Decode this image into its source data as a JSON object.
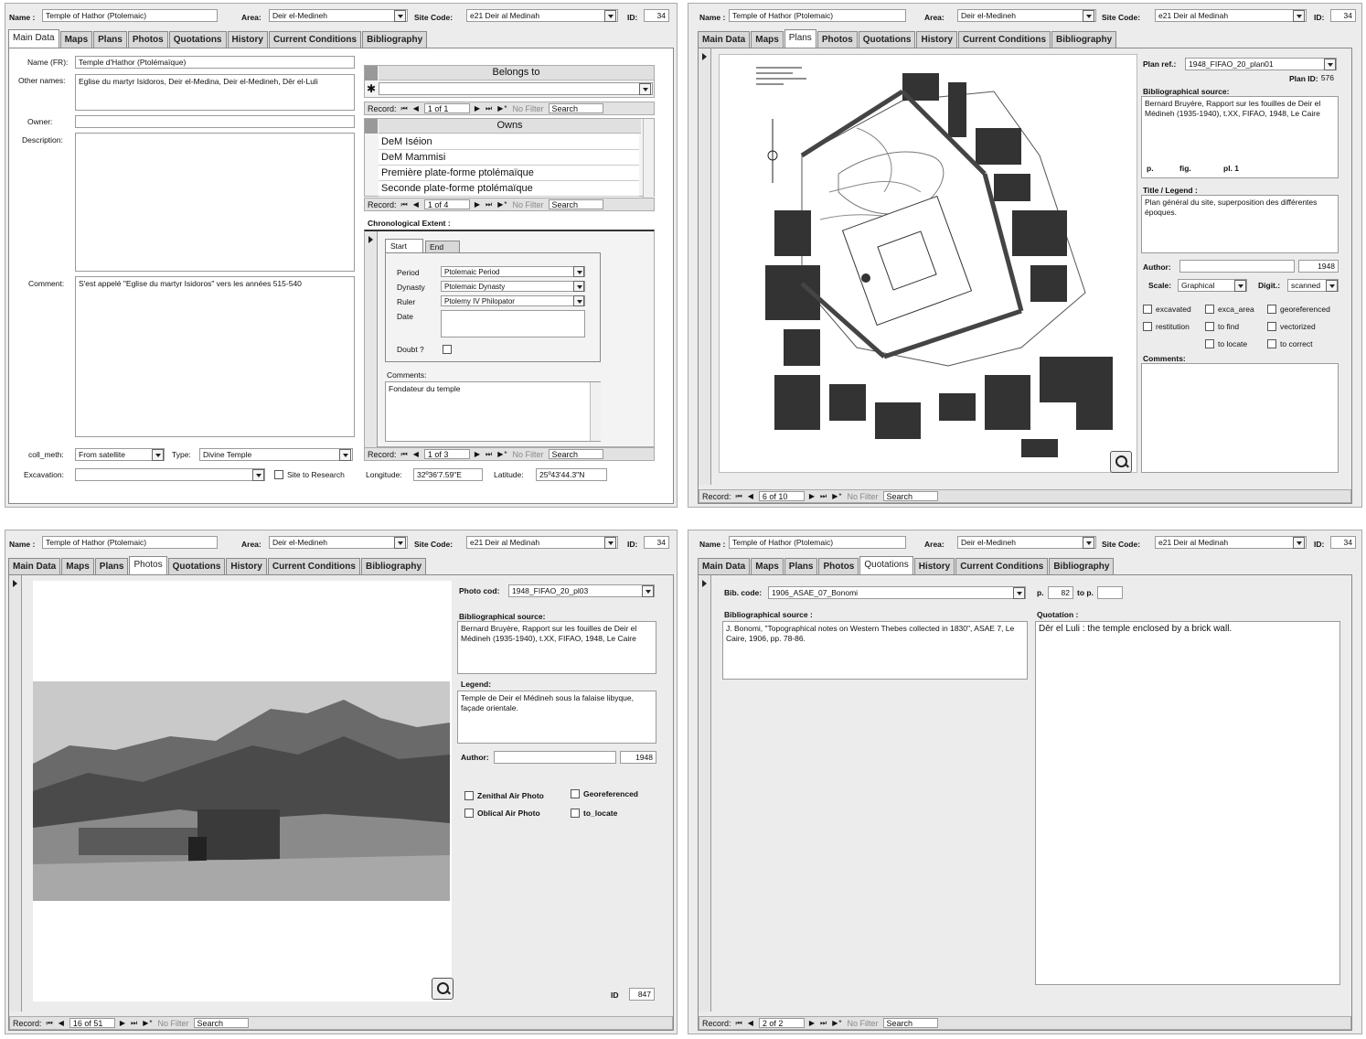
{
  "header": {
    "name_label": "Name :",
    "name_value": "Temple of Hathor (Ptolemaic)",
    "area_label": "Area:",
    "area_value": "Deir el-Medineh",
    "site_code_label": "Site Code:",
    "site_code_value": "e21 Deir al Medinah",
    "id_label": "ID:",
    "id_value": "34"
  },
  "tabs": [
    "Main Data",
    "Maps",
    "Plans",
    "Photos",
    "Quotations",
    "History",
    "Current Conditions",
    "Bibliography"
  ],
  "recbar": {
    "record_label": "Record:",
    "nav_first": "⏮",
    "nav_prev": "◀",
    "nav_next": "▶",
    "nav_last": "⏭",
    "nav_new": "▶*",
    "no_filter": "No Filter",
    "search": "Search"
  },
  "main": {
    "name_fr_label": "Name (FR):",
    "name_fr_value": "Temple d'Hathor (Ptolémaïque)",
    "other_names_label": "Other names:",
    "other_names_value": "Eglise du martyr Isidoros, Deir el-Medina, Deir el-Medineh, Dēr el-Luli",
    "owner_label": "Owner:",
    "owner_value": "",
    "description_label": "Description:",
    "description_value": "",
    "comment_label": "Comment:",
    "comment_value": "S'est appelé \"Eglise du martyr Isidoros\" vers les années 515-540",
    "coll_meth_label": "coll_meth:",
    "coll_meth_value": "From satellite",
    "type_label": "Type:",
    "type_value": "Divine Temple",
    "excavation_label": "Excavation:",
    "excavation_value": "",
    "site_research_label": "Site to Research",
    "longitude_label": "Longitude:",
    "longitude_value": "32º36'7.59\"E",
    "latitude_label": "Latitude:",
    "latitude_value": "25º43'44.3\"N",
    "belongs_to_title": "Belongs to",
    "belongs_new_row": "✱",
    "belongs_record": "1 of 1",
    "owns_title": "Owns",
    "owns_items": [
      "DeM Iséion",
      "DeM Mammisi",
      "Première plate-forme ptolémaïque",
      "Seconde plate-forme ptolémaïque"
    ],
    "owns_record": "1 of 4",
    "chrono_label": "Chronological Extent :",
    "chrono_tabs": [
      "Start",
      "End"
    ],
    "period_label": "Period",
    "period_value": "Ptolemaic Period",
    "dynasty_label": "Dynasty",
    "dynasty_value": "Ptolemaic Dynasty",
    "ruler_label": "Ruler",
    "ruler_value": "Ptolemy IV Philopator",
    "date_label": "Date",
    "doubt_label": "Doubt ?",
    "comments_label": "Comments:",
    "comments_value": "Fondateur du temple",
    "chrono_record": "1 of 3"
  },
  "plans": {
    "plan_ref_label": "Plan ref.:",
    "plan_ref_value": "1948_FIFAO_20_plan01",
    "plan_id_label": "Plan ID:",
    "plan_id_value": "576",
    "biblio_label": "Bibliographical source:",
    "biblio_value": "Bernard Bruyère, Rapport sur les fouilles de Deir el Médineh (1935-1940), t.XX, FIFAO, 1948, Le Caire",
    "p_label": "p.",
    "fig_label": "fig.",
    "pl_label": "pl. 1",
    "title_label": "Title / Legend :",
    "title_value": "Plan général du site, superposition des différentes époques.",
    "author_label": "Author:",
    "author_value": "",
    "year_value": "1948",
    "scale_label": "Scale:",
    "scale_value": "Graphical",
    "digit_label": "Digit.:",
    "digit_value": "scanned",
    "checks": [
      "excavated",
      "exca_area",
      "georeferenced",
      "restitution",
      "to find",
      "vectorized",
      "to locate",
      "to correct"
    ],
    "comments_label": "Comments:",
    "record": "6 of 10"
  },
  "photos": {
    "photo_cod_label": "Photo cod:",
    "photo_cod_value": "1948_FIFAO_20_pl03",
    "biblio_label": "Bibliographical source:",
    "biblio_value": "Bernard Bruyère, Rapport sur les fouilles de Deir el Médineh (1935-1940), t.XX, FIFAO, 1948, Le Caire",
    "legend_label": "Legend:",
    "legend_value": "Temple de Deir el Médineh sous la falaise libyque, façade orientale.",
    "author_label": "Author:",
    "author_value": "",
    "year_value": "1948",
    "checks": [
      "Zenithal Air Photo",
      "Georeferenced",
      "Oblical Air Photo",
      "to_locate"
    ],
    "id_label": "ID",
    "id_value": "847",
    "record": "16 of 51"
  },
  "quotations": {
    "bib_code_label": "Bib. code:",
    "bib_code_value": "1906_ASAE_07_Bonomi",
    "p_label": "p.",
    "p_value": "82",
    "to_p_label": "to p.",
    "to_p_value": "",
    "biblio_label": "Bibliographical source :",
    "biblio_value": "J. Bonomi, \"Topographical notes on Western Thebes collected in 1830\", ASAE 7, Le Caire, 1906, pp. 78-86.",
    "quotation_label": "Quotation :",
    "quotation_value": "Dēr el Luli : the temple enclosed by a brick wall.",
    "record": "2 of 2"
  }
}
